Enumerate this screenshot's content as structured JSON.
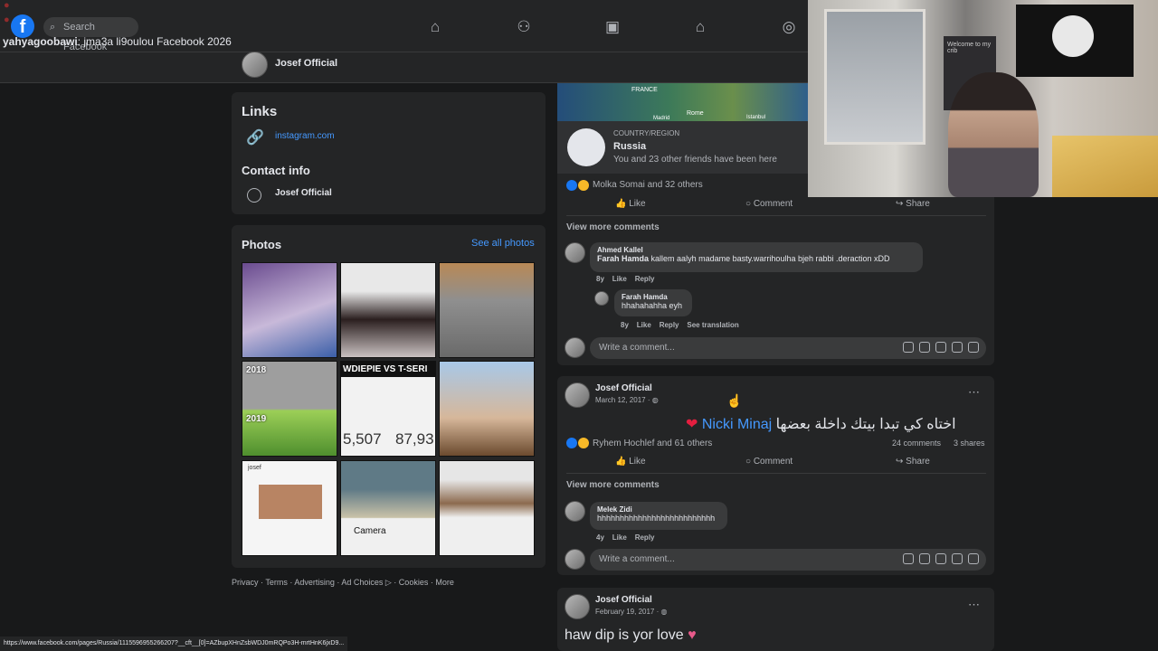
{
  "chat": [
    {
      "user": "yahyagoobawi",
      "text": "jma3a li9oulou Facebook 2026"
    }
  ],
  "header": {
    "search_placeholder": "Search Facebook"
  },
  "profile_bar": {
    "name": "Josef Official"
  },
  "links": {
    "title": "Links",
    "instagram": "instagram.com",
    "contact_title": "Contact info",
    "contact_name": "Josef Official"
  },
  "photos": {
    "title": "Photos",
    "see_all": "See all photos",
    "year_a": "2018",
    "year_b": "2019",
    "meme_title": "WDIEPIE VS T-SERI",
    "meme_num_a": "5,507",
    "meme_num_b": "87,93",
    "camera": "Camera",
    "josef_note": "josef"
  },
  "footer": {
    "links": "Privacy · Terms · Advertising · Ad Choices ▷ · Cookies · More",
    "status_url": "https://www.facebook.com/pages/Russia/1115596955266207?__cft__[0]=AZbupXHnZsbWDJ0mRQPo3H-mrtHnK6jxD9..."
  },
  "map": {
    "country_label": "FRANCE",
    "city_a": "Rome",
    "city_b": "Istanbul",
    "city_c": "Madrid"
  },
  "checkin": {
    "region_label": "COUNTRY/REGION",
    "region": "Russia",
    "friends": "You and 23 other friends have been here"
  },
  "post1": {
    "reactions": "Molka Somai and 32 others",
    "like": "Like",
    "comment": "Comment",
    "share": "Share",
    "view_more": "View more comments",
    "c1_name": "Ahmed Kallel",
    "c1_mention": "Farah Hamda",
    "c1_text": "kallem aalyh madame basty.warrihoulha bjeh rabbi .deraction xDD",
    "c1_age": "8y",
    "c1_like": "Like",
    "c1_reply": "Reply",
    "c2_name": "Farah Hamda",
    "c2_text": "hhahahahha eyh",
    "c2_age": "8y",
    "c2_like": "Like",
    "c2_reply": "Reply",
    "c2_trans": "See translation",
    "write": "Write a comment..."
  },
  "post2": {
    "author": "Josef Official",
    "date": "March 12, 2017 · ",
    "text_ar": "اختاه كي تبدا بيتك داخلة بعضها",
    "tag": "Nicki Minaj",
    "reactions": "Ryhem Hochlef and 61 others",
    "comments": "24 comments",
    "shares": "3 shares",
    "like": "Like",
    "comment": "Comment",
    "share": "Share",
    "view_more": "View more comments",
    "c_name": "Melek Zidi",
    "c_text": "hhhhhhhhhhhhhhhhhhhhhhhhhh",
    "c_age": "4y",
    "c_like": "Like",
    "c_reply": "Reply",
    "write": "Write a comment..."
  },
  "post3": {
    "author": "Josef Official",
    "date": "February 19, 2017 · ",
    "text": "haw dip is yor love"
  },
  "webcam": {
    "sign": "Welcome to my crib"
  },
  "colors": {
    "bg": "#18191a",
    "card": "#242526",
    "accent": "#4599ff",
    "fb_blue": "#1877f2"
  }
}
